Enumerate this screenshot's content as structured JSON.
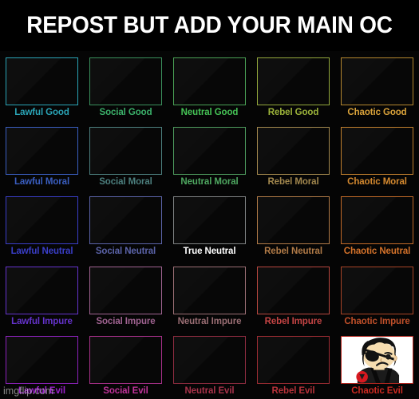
{
  "header": {
    "title": "REPOST BUT ADD YOUR MAIN OC"
  },
  "watermark": {
    "text": "imgflip.com"
  },
  "grid": {
    "columns": [
      "Lawful",
      "Social",
      "Neutral",
      "Rebel",
      "Chaotic"
    ],
    "rows": [
      "Good",
      "Moral",
      "Neutral",
      "Impure",
      "Evil"
    ],
    "cells": [
      {
        "label": "Lawful Good",
        "color": "#2aa3b5",
        "border": "#2aa3b5",
        "filled": false
      },
      {
        "label": "Social Good",
        "color": "#3bb06a",
        "border": "#3a8f5c",
        "filled": false
      },
      {
        "label": "Neutral Good",
        "color": "#45c255",
        "border": "#49a055",
        "filled": false
      },
      {
        "label": "Rebel Good",
        "color": "#9cb33a",
        "border": "#93a83c",
        "filled": false
      },
      {
        "label": "Chaotic Good",
        "color": "#d9a23a",
        "border": "#b4872f",
        "filled": false
      },
      {
        "label": "Lawful Moral",
        "color": "#3a5ec0",
        "border": "#3a5ec0",
        "filled": false
      },
      {
        "label": "Social Moral",
        "color": "#4c7f7e",
        "border": "#4c7f7e",
        "filled": false
      },
      {
        "label": "Neutral Moral",
        "color": "#4fa861",
        "border": "#4d9a5d",
        "filled": false
      },
      {
        "label": "Rebel Moral",
        "color": "#a3884e",
        "border": "#a3884e",
        "filled": false
      },
      {
        "label": "Chaotic Moral",
        "color": "#d4892f",
        "border": "#c07f2e",
        "filled": false
      },
      {
        "label": "Lawful Neutral",
        "color": "#3a3ec8",
        "border": "#3a3ec8",
        "filled": false
      },
      {
        "label": "Social Neutral",
        "color": "#5b63a8",
        "border": "#5b63a8",
        "filled": false
      },
      {
        "label": "True Neutral",
        "color": "#ffffff",
        "border": "#7e8182",
        "filled": false
      },
      {
        "label": "Rebel Neutral",
        "color": "#b07a47",
        "border": "#b07a47",
        "filled": false
      },
      {
        "label": "Chaotic Neutral",
        "color": "#d4722a",
        "border": "#c26a28",
        "filled": false
      },
      {
        "label": "Lawful Impure",
        "color": "#6533cc",
        "border": "#6533cc",
        "filled": false
      },
      {
        "label": "Social Impure",
        "color": "#a06391",
        "border": "#a06391",
        "filled": false
      },
      {
        "label": "Neutral Impure",
        "color": "#9a6e74",
        "border": "#9a6e74",
        "filled": false
      },
      {
        "label": "Rebel Impure",
        "color": "#c44444",
        "border": "#b8473f",
        "filled": false
      },
      {
        "label": "Chaotic Impure",
        "color": "#c1502a",
        "border": "#a84427",
        "filled": false
      },
      {
        "label": "Lawful Evil",
        "color": "#9b20cc",
        "border": "#8c22bb",
        "filled": false
      },
      {
        "label": "Social Evil",
        "color": "#c0339a",
        "border": "#a8308a",
        "filled": false
      },
      {
        "label": "Neutral Evil",
        "color": "#a8334a",
        "border": "#8e2c40",
        "filled": false
      },
      {
        "label": "Rebel Evil",
        "color": "#b8323a",
        "border": "#9c2c33",
        "filled": false
      },
      {
        "label": "Chaotic Evil",
        "color": "#cc2b22",
        "border": "#b52820",
        "filled": true,
        "art": "oc-character-eyepatch"
      }
    ]
  }
}
